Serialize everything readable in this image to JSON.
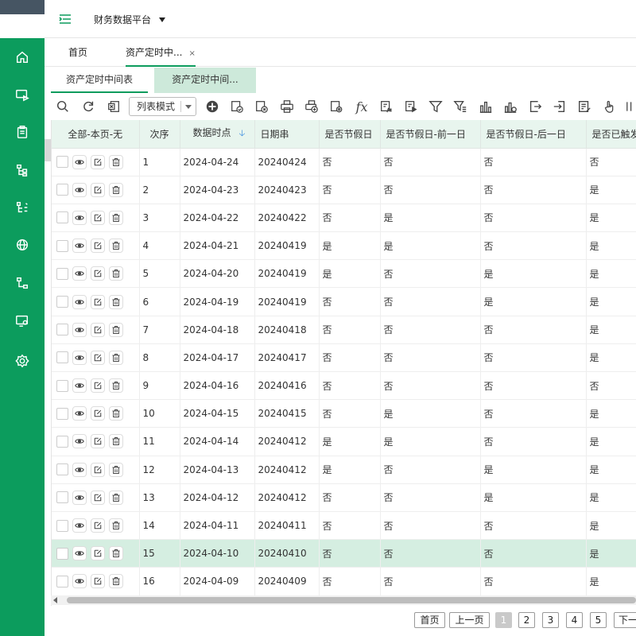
{
  "header": {
    "platform": "财务数据平台"
  },
  "tabs": [
    {
      "label": "首页"
    },
    {
      "label": "资产定时中...",
      "close": "×"
    }
  ],
  "subtabs": [
    {
      "label": "资产定时中间表"
    },
    {
      "label": "资产定时中间..."
    }
  ],
  "toolbar": {
    "mode": "列表模式",
    "fx": "fx"
  },
  "grid": {
    "columns": [
      "全部-本页-无",
      "次序",
      "数据时点",
      "日期串",
      "是否节假日",
      "是否节假日-前一日",
      "是否节假日-后一日",
      "是否已触发"
    ],
    "rows": [
      [
        "1",
        "2024-04-24",
        "20240424",
        "否",
        "否",
        "否",
        "否"
      ],
      [
        "2",
        "2024-04-23",
        "20240423",
        "否",
        "否",
        "否",
        "是"
      ],
      [
        "3",
        "2024-04-22",
        "20240422",
        "否",
        "是",
        "否",
        "是"
      ],
      [
        "4",
        "2024-04-21",
        "20240419",
        "是",
        "是",
        "否",
        "是"
      ],
      [
        "5",
        "2024-04-20",
        "20240419",
        "是",
        "否",
        "是",
        "是"
      ],
      [
        "6",
        "2024-04-19",
        "20240419",
        "否",
        "否",
        "是",
        "是"
      ],
      [
        "7",
        "2024-04-18",
        "20240418",
        "否",
        "否",
        "否",
        "是"
      ],
      [
        "8",
        "2024-04-17",
        "20240417",
        "否",
        "否",
        "否",
        "是"
      ],
      [
        "9",
        "2024-04-16",
        "20240416",
        "否",
        "否",
        "否",
        "否"
      ],
      [
        "10",
        "2024-04-15",
        "20240415",
        "否",
        "是",
        "否",
        "是"
      ],
      [
        "11",
        "2024-04-14",
        "20240412",
        "是",
        "是",
        "否",
        "是"
      ],
      [
        "12",
        "2024-04-13",
        "20240412",
        "是",
        "否",
        "是",
        "是"
      ],
      [
        "13",
        "2024-04-12",
        "20240412",
        "否",
        "否",
        "是",
        "是"
      ],
      [
        "14",
        "2024-04-11",
        "20240411",
        "否",
        "否",
        "否",
        "是"
      ],
      [
        "15",
        "2024-04-10",
        "20240410",
        "否",
        "否",
        "否",
        "是"
      ],
      [
        "16",
        "2024-04-09",
        "20240409",
        "否",
        "否",
        "否",
        "是"
      ]
    ],
    "selected_row": "15"
  },
  "pager": {
    "first": "首页",
    "prev": "上一页",
    "pages": [
      "1",
      "2",
      "3",
      "4",
      "5"
    ],
    "current": "1",
    "next": "下一"
  },
  "colors": {
    "brand": "#0c9c5d",
    "header_bg": "#e8f5ee",
    "selected": "#d5eee1"
  }
}
